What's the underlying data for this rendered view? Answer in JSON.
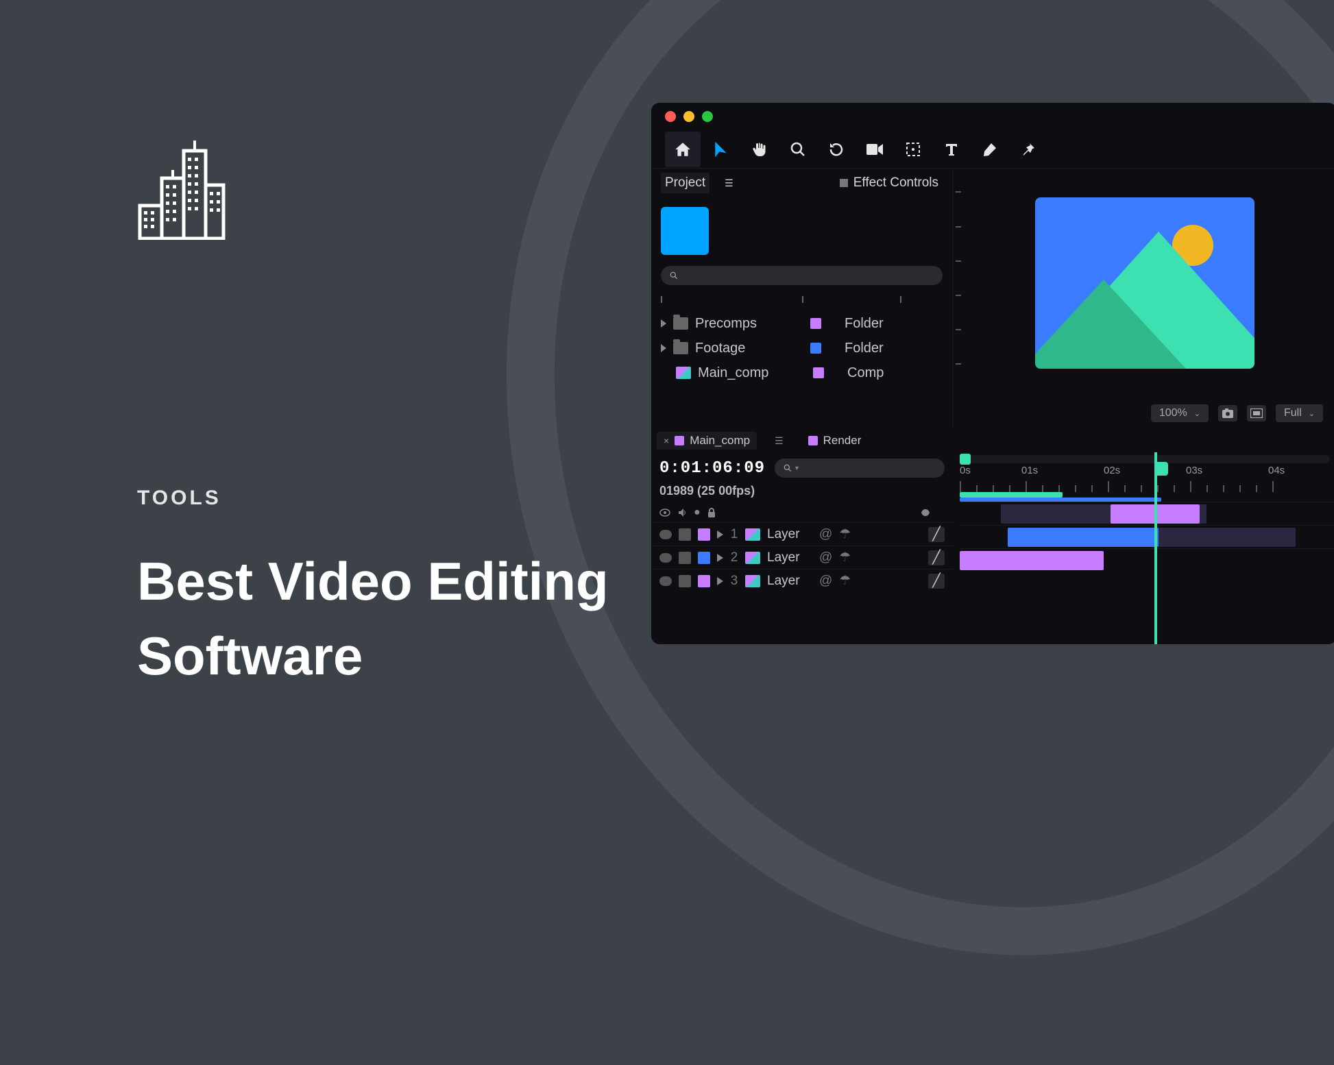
{
  "hero": {
    "category": "TOOLS",
    "title": "Best Video Editing Software"
  },
  "editor": {
    "panels": {
      "project_tab": "Project",
      "effect_controls_tab": "Effect Controls"
    },
    "project_items": [
      {
        "name": "Precomps",
        "type": "Folder",
        "swatch": "v",
        "is_folder": true
      },
      {
        "name": "Footage",
        "type": "Folder",
        "swatch": "b",
        "is_folder": true
      },
      {
        "name": "Main_comp",
        "type": "Comp",
        "swatch": "v",
        "is_folder": false
      }
    ],
    "preview": {
      "zoom": "100%",
      "quality": "Full"
    },
    "timeline": {
      "tab_main": "Main_comp",
      "tab_render": "Render",
      "timecode": "0:01:06:09",
      "meta": "01989 (25 00fps)",
      "ruler_labels": [
        "0s",
        "01s",
        "02s",
        "03s",
        "04s"
      ],
      "layers": [
        {
          "n": "1",
          "name": "Layer",
          "swatch": "v"
        },
        {
          "n": "2",
          "name": "Layer",
          "swatch": "b"
        },
        {
          "n": "3",
          "name": "Layer",
          "swatch": "v"
        }
      ]
    }
  }
}
